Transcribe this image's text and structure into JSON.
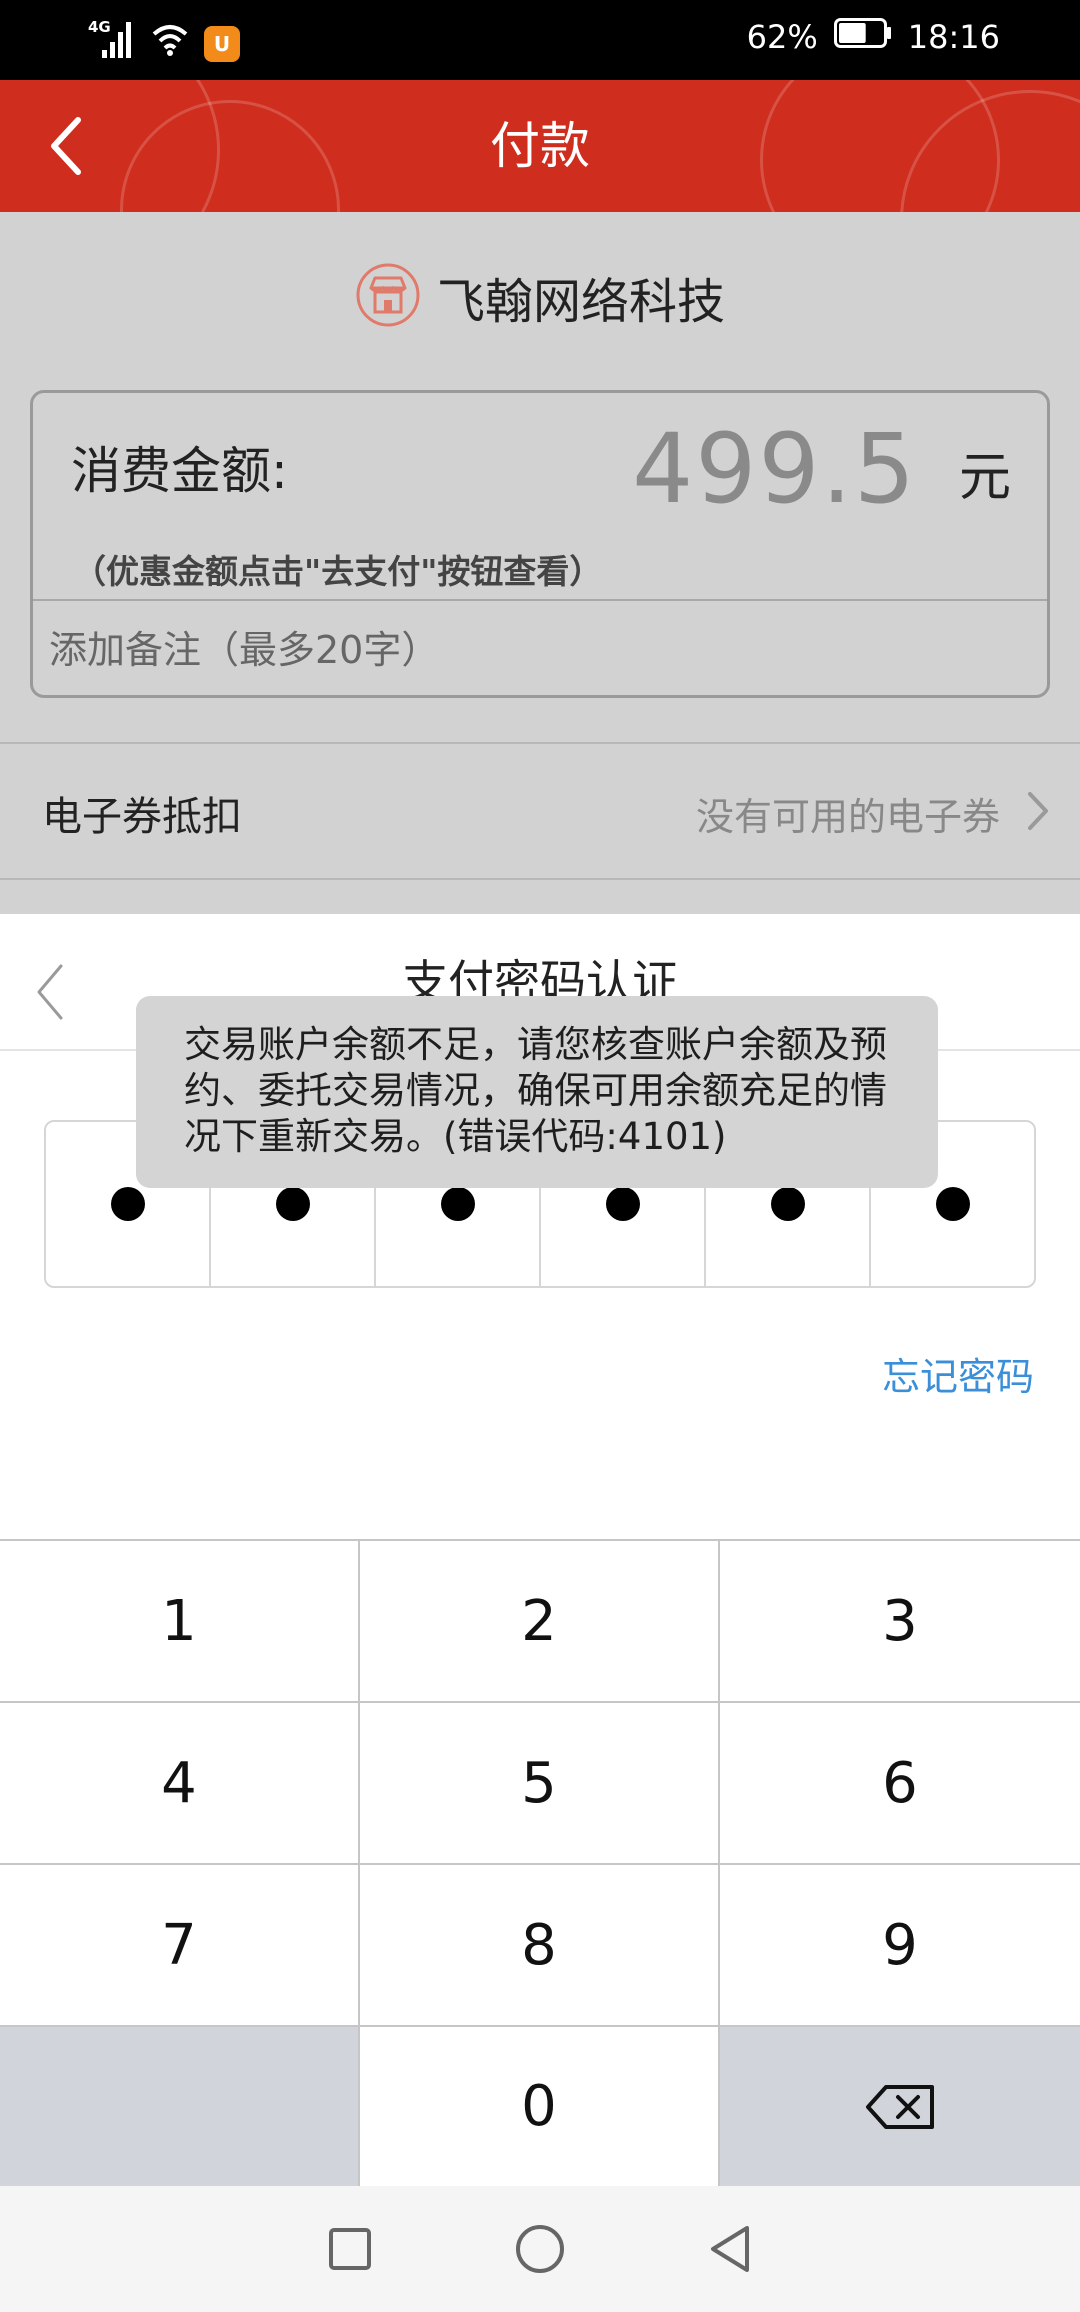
{
  "status_bar": {
    "network_label": "4G",
    "battery_percent": "62%",
    "time": "18:16",
    "battery_level": 0.62,
    "icons": [
      "signal-icon",
      "wifi-icon",
      "app-notification-icon",
      "battery-icon"
    ]
  },
  "header": {
    "title": "付款",
    "background_color": "#cf2d1d"
  },
  "merchant": {
    "name": "飞翰网络科技",
    "icon": "store-icon"
  },
  "payment": {
    "amount_label": "消费金额:",
    "amount": "499.5",
    "unit": "元",
    "discount_hint": "（优惠金额点击\"去支付\"按钮查看）",
    "memo_placeholder": "添加备注（最多20字）"
  },
  "coupon": {
    "label": "电子券抵扣",
    "value": "没有可用的电子券"
  },
  "password_sheet": {
    "title": "支付密码认证",
    "forgot_label": "忘记密码",
    "pin_length": 6,
    "pin_filled": 6,
    "link_color": "#3b8fd8"
  },
  "keypad": {
    "keys": [
      "1",
      "2",
      "3",
      "4",
      "5",
      "6",
      "7",
      "8",
      "9",
      "",
      "0",
      "delete"
    ]
  },
  "toast": {
    "message": "交易账户余额不足，请您核查账户余额及预约、委托交易情况，确保可用余额充足的情况下重新交易。(错误代码:4101)"
  },
  "nav_bar": {
    "buttons": [
      "recent-apps",
      "home",
      "back"
    ]
  }
}
